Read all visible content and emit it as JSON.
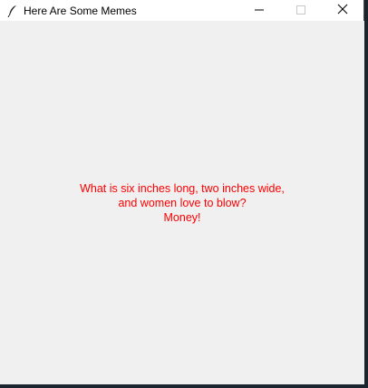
{
  "window": {
    "title": "Here Are Some Memes",
    "icon": "feather-icon",
    "controls": {
      "minimize_icon": "minimize-icon",
      "maximize_icon": "maximize-icon",
      "close_icon": "close-icon"
    }
  },
  "content": {
    "lines": [
      "What is six inches long, two inches wide,",
      "and women love to blow?",
      "Money!"
    ],
    "text_color": "#ff0000",
    "background_color": "#f0f0f0"
  }
}
